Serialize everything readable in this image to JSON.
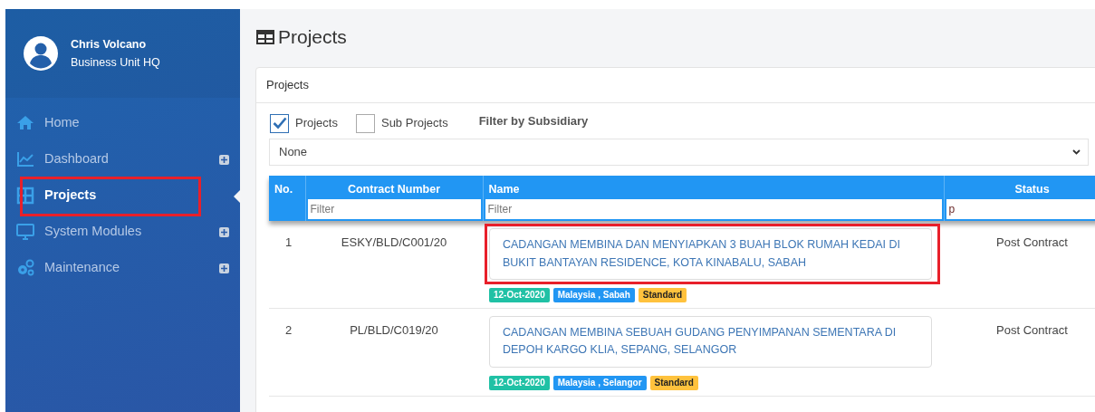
{
  "user": {
    "name": "Chris Volcano",
    "unit": "Business Unit HQ"
  },
  "sidebar": {
    "items": [
      {
        "label": "Home",
        "kind": "home",
        "selected": false,
        "expandable": false,
        "highlighted": false
      },
      {
        "label": "Dashboard",
        "kind": "chart",
        "selected": false,
        "expandable": true,
        "highlighted": false
      },
      {
        "label": "Projects",
        "kind": "grid",
        "selected": true,
        "expandable": false,
        "highlighted": true
      },
      {
        "label": "System Modules",
        "kind": "monitor",
        "selected": false,
        "expandable": true,
        "highlighted": false
      },
      {
        "label": "Maintenance",
        "kind": "gears",
        "selected": false,
        "expandable": true,
        "highlighted": false
      }
    ]
  },
  "page_title": "Projects",
  "card": {
    "title": "Projects",
    "checkboxes": [
      {
        "label": "Projects",
        "checked": true
      },
      {
        "label": "Sub Projects",
        "checked": false
      }
    ],
    "filter_label": "Filter by Subsidiary",
    "subsidiary_select": {
      "value": "None"
    },
    "table": {
      "columns": [
        {
          "label": "No."
        },
        {
          "label": "Contract Number",
          "filter_placeholder": "Filter"
        },
        {
          "label": "Name",
          "filter_placeholder": "Filter"
        },
        {
          "label": "Status",
          "filter_value": "p"
        }
      ],
      "rows": [
        {
          "no": "1",
          "contract_number": "ESKY/BLD/C001/20",
          "name": "CADANGAN MEMBINA DAN MENYIAPKAN 3 BUAH BLOK RUMAH KEDAI DI BUKIT BANTAYAN RESIDENCE, KOTA KINABALU, SABAH",
          "highlighted": true,
          "status": "Post Contract",
          "tags": [
            {
              "text": "12-Oct-2020",
              "color": "#20c1a5"
            },
            {
              "text": "Malaysia , Sabah",
              "color": "#2196f3"
            },
            {
              "text": "Standard",
              "color": "#ffc23d"
            }
          ]
        },
        {
          "no": "2",
          "contract_number": "PL/BLD/C019/20",
          "name": "CADANGAN MEMBINA SEBUAH GUDANG PENYIMPANAN SEMENTARA DI DEPOH KARGO KLIA, SEPANG, SELANGOR",
          "highlighted": false,
          "status": "Post Contract",
          "tags": [
            {
              "text": "12-Oct-2020",
              "color": "#20c1a5"
            },
            {
              "text": "Malaysia , Selangor",
              "color": "#2196f3"
            },
            {
              "text": "Standard",
              "color": "#ffc23d"
            }
          ]
        }
      ]
    }
  }
}
